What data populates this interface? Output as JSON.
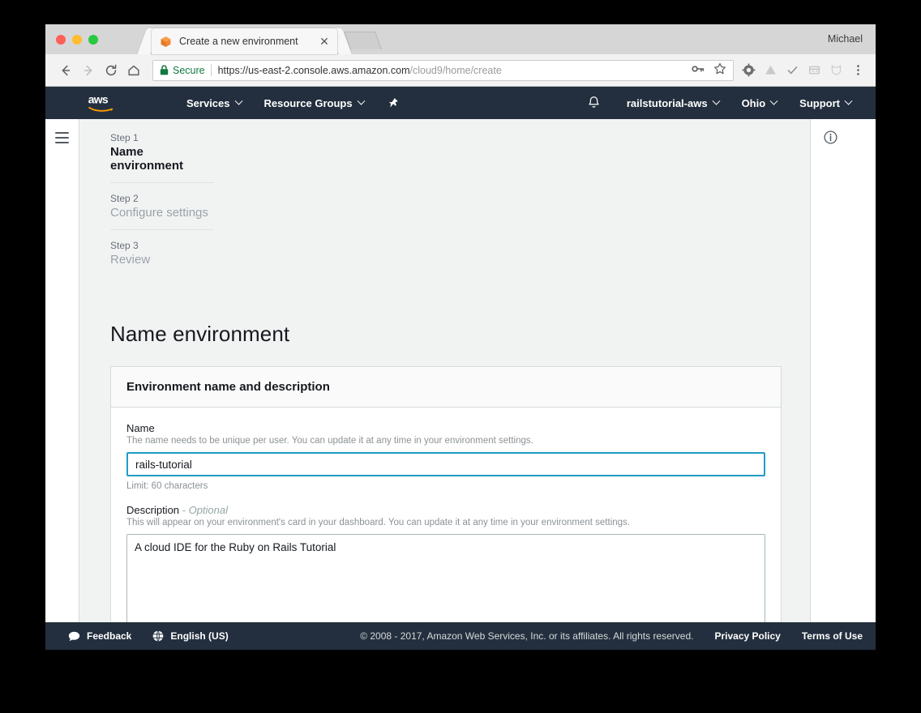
{
  "browser": {
    "tab_title": "Create a new environment",
    "tab_favicon_name": "cloud9-cube-icon",
    "close_glyph": "✕",
    "profile_name": "Michael",
    "back_glyph": "←",
    "forward_glyph": "→",
    "reload_glyph": "⟳",
    "home_glyph": "⌂",
    "security_label": "Secure",
    "url_scheme_host": "https://us-east-2.console.aws.amazon.com",
    "url_path": "/cloud9/home/create",
    "extensions": [
      "gear-extension-icon",
      "google-drive-icon",
      "checkmark-extension-icon",
      "form-filler-icon",
      "shield-fox-icon",
      "chrome-menu-icon"
    ]
  },
  "aws_nav": {
    "logo_alt": "aws",
    "services_label": "Services",
    "resource_groups_label": "Resource Groups",
    "pin_icon_name": "pin-icon",
    "bell_icon_name": "notification-bell-icon",
    "account_label": "railstutorial-aws",
    "region_label": "Ohio",
    "support_label": "Support"
  },
  "wizard": {
    "steps": [
      {
        "label": "Step 1",
        "title": "Name environment",
        "active": true
      },
      {
        "label": "Step 2",
        "title": "Configure settings",
        "active": false
      },
      {
        "label": "Step 3",
        "title": "Review",
        "active": false
      }
    ]
  },
  "main": {
    "page_title": "Name environment",
    "card_title": "Environment name and description",
    "name_field": {
      "label": "Name",
      "hint": "The name needs to be unique per user. You can update it at any time in your environment settings.",
      "value": "rails-tutorial",
      "placeholder": "",
      "sub": "Limit: 60 characters"
    },
    "description_field": {
      "label": "Description",
      "optional": " - Optional",
      "hint": "This will appear on your environment's card in your dashboard. You can update it at any time in your environment settings.",
      "value": "A cloud IDE for the Ruby on Rails Tutorial",
      "placeholder": ""
    },
    "info_icon_name": "info-circle-icon"
  },
  "footer": {
    "feedback_label": "Feedback",
    "language_label": "English (US)",
    "copyright": "© 2008 - 2017, Amazon Web Services, Inc. or its affiliates. All rights reserved.",
    "privacy_label": "Privacy Policy",
    "terms_label": "Terms of Use"
  },
  "colors": {
    "aws_navy": "#232f3e",
    "aws_orange": "#ff9900",
    "focus_blue": "#1f9dc4",
    "panel_grey": "#f1f3f3",
    "secure_green": "#10793f"
  }
}
